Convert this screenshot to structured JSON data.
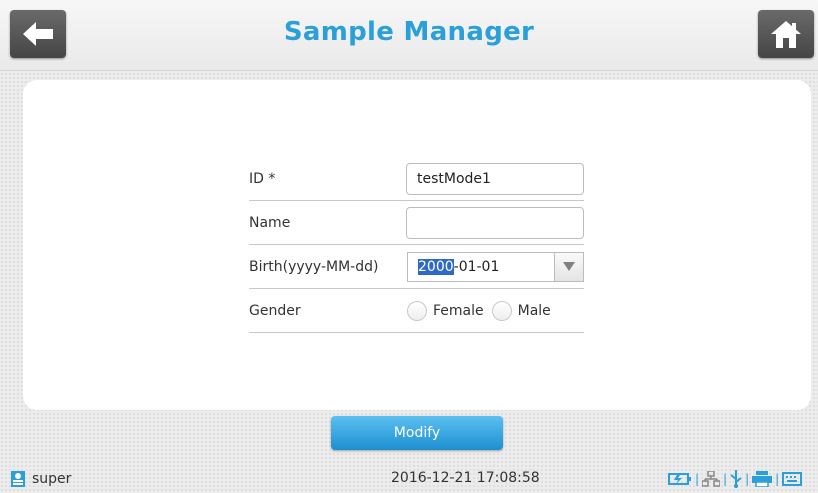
{
  "header": {
    "title": "Sample Manager",
    "back_icon": "arrow-left-icon",
    "home_icon": "home-icon"
  },
  "form": {
    "id_label": "ID *",
    "id_value": "testMode1",
    "name_label": "Name",
    "name_value": "",
    "birth_label": "Birth(yyyy-MM-dd)",
    "birth_selected": "2000",
    "birth_rest": "-01-01",
    "gender_label": "Gender",
    "gender_options": [
      "Female",
      "Male"
    ]
  },
  "actions": {
    "modify_label": "Modify"
  },
  "status_bar": {
    "user": "super",
    "datetime": "2016-12-21 17:08:58",
    "icons": [
      "battery-icon",
      "network-icon",
      "usb-icon",
      "printer-icon",
      "keyboard-icon"
    ]
  },
  "colors": {
    "accent": "#2a9fd8",
    "header_button": "#555555",
    "selection": "#2f69c8"
  }
}
